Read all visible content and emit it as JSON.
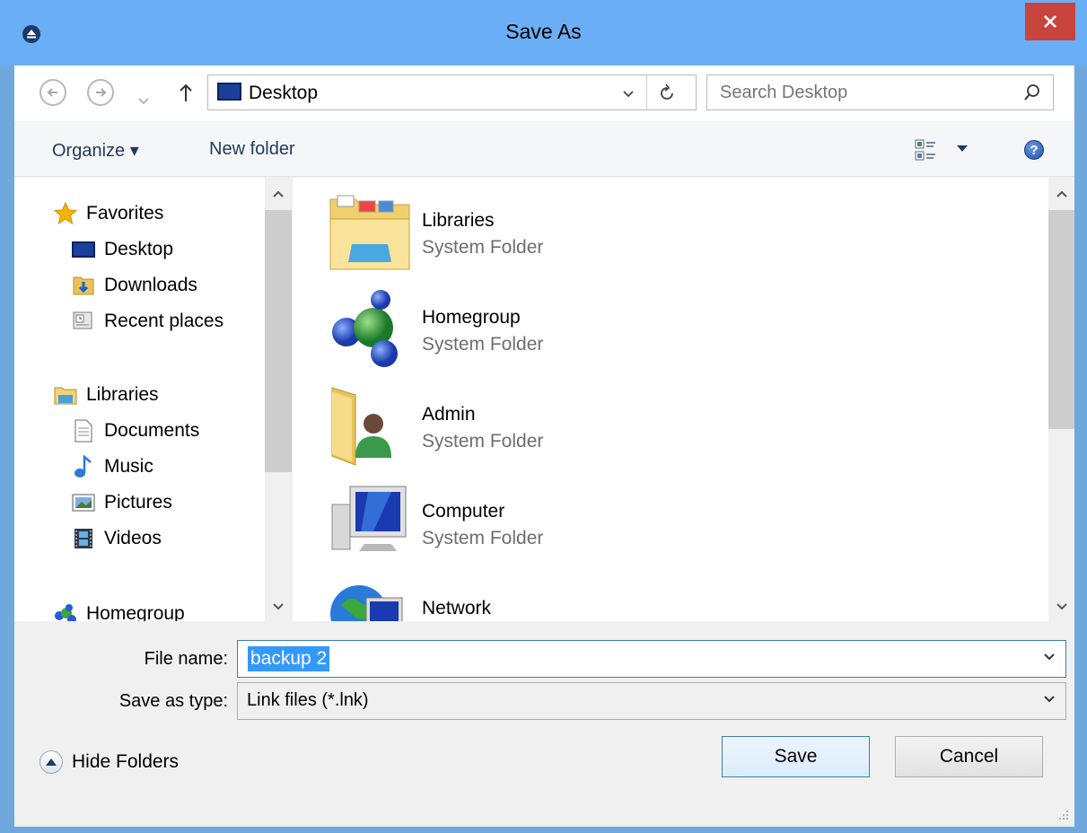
{
  "window": {
    "title": "Save As"
  },
  "address": {
    "location": "Desktop"
  },
  "search": {
    "placeholder": "Search Desktop"
  },
  "toolbar": {
    "organize_label": "Organize ▾",
    "new_folder_label": "New folder"
  },
  "sidebar": {
    "items": [
      {
        "label": "Favorites",
        "icon": "star-icon"
      },
      {
        "label": "Desktop",
        "icon": "desktop-icon"
      },
      {
        "label": "Downloads",
        "icon": "downloads-icon"
      },
      {
        "label": "Recent places",
        "icon": "recent-places-icon"
      },
      {
        "label": "Libraries",
        "icon": "libraries-icon"
      },
      {
        "label": "Documents",
        "icon": "documents-icon"
      },
      {
        "label": "Music",
        "icon": "music-icon"
      },
      {
        "label": "Pictures",
        "icon": "pictures-icon"
      },
      {
        "label": "Videos",
        "icon": "videos-icon"
      },
      {
        "label": "Homegroup",
        "icon": "homegroup-icon"
      }
    ]
  },
  "content": {
    "items": [
      {
        "name": "Libraries",
        "type": "System Folder",
        "icon": "libraries-folder-icon"
      },
      {
        "name": "Homegroup",
        "type": "System Folder",
        "icon": "homegroup-icon"
      },
      {
        "name": "Admin",
        "type": "System Folder",
        "icon": "user-folder-icon"
      },
      {
        "name": "Computer",
        "type": "System Folder",
        "icon": "computer-icon"
      },
      {
        "name": "Network",
        "type": "",
        "icon": "network-icon"
      }
    ]
  },
  "form": {
    "file_name_label": "File name:",
    "file_name_value": "backup 2",
    "save_type_label": "Save as type:",
    "save_type_value": "Link files (*.lnk)"
  },
  "footer": {
    "hide_folders_label": "Hide Folders",
    "save_label": "Save",
    "cancel_label": "Cancel"
  },
  "colors": {
    "titlebar": "#6aaef6",
    "close": "#c7453c",
    "selection": "#3399ff",
    "accent_border": "#3c7fb1"
  }
}
